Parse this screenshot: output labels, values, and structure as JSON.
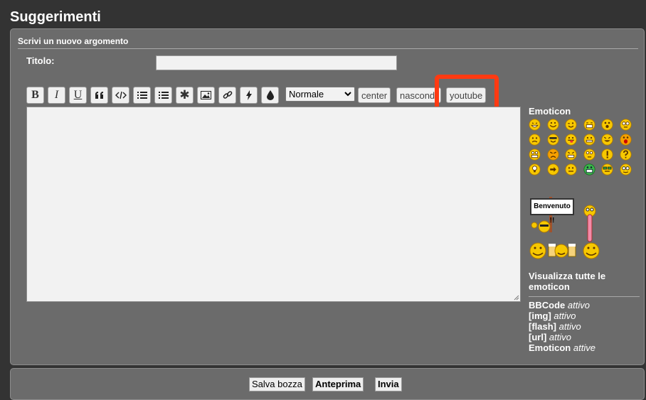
{
  "page": {
    "title": "Suggerimenti"
  },
  "form": {
    "header": "Scrivi un nuovo argomento",
    "title_label": "Titolo:",
    "title_value": ""
  },
  "toolbar": {
    "buttons": [
      {
        "name": "bold",
        "label": "B",
        "icon": "bold-icon"
      },
      {
        "name": "italic",
        "label": "I",
        "icon": "italic-icon"
      },
      {
        "name": "underline",
        "label": "U",
        "icon": "underline-icon"
      },
      {
        "name": "quote",
        "icon": "quote-icon"
      },
      {
        "name": "code",
        "icon": "code-icon"
      },
      {
        "name": "list",
        "icon": "bulleted-list-icon"
      },
      {
        "name": "ordered-list",
        "icon": "numbered-list-icon"
      },
      {
        "name": "list-item",
        "icon": "asterisk-icon"
      },
      {
        "name": "image",
        "icon": "image-icon"
      },
      {
        "name": "link",
        "icon": "link-icon"
      },
      {
        "name": "flash",
        "icon": "lightning-icon"
      },
      {
        "name": "color",
        "icon": "droplet-icon"
      }
    ],
    "size_select": "Normale",
    "center_label": "center",
    "nascondi_label": "nascond",
    "youtube_label": "youtube"
  },
  "sidebar": {
    "emoticon_title": "Emoticon",
    "sign_text": "Benvenuto !!",
    "view_all_link": "Visualizza tutte le emoticon",
    "status": [
      {
        "key": "BBCode",
        "value": "attivo"
      },
      {
        "key": "[img]",
        "value": "attivo"
      },
      {
        "key": "[flash]",
        "value": "attivo"
      },
      {
        "key": "[url]",
        "value": "attivo"
      },
      {
        "key": "Emoticon",
        "value": "attive"
      }
    ]
  },
  "footer": {
    "draft_label": "Salva bozza",
    "preview_label": "Anteprima",
    "submit_label": "Invia"
  },
  "colors": {
    "highlight": "#ff3a12",
    "panel": "#6b6b6b",
    "background": "#333333"
  }
}
